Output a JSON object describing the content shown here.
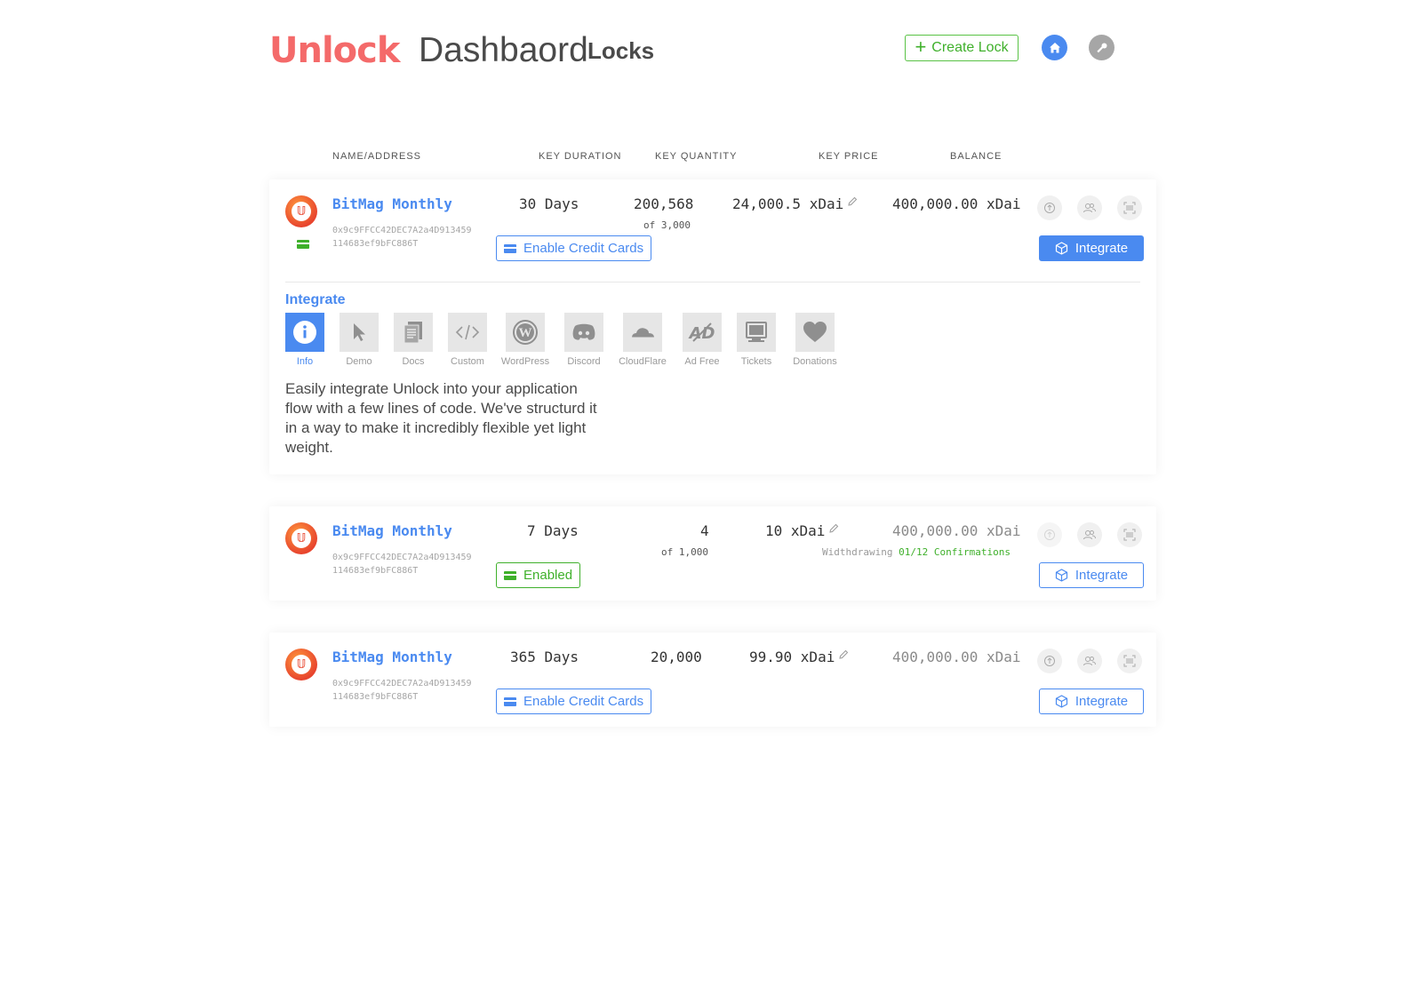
{
  "header": {
    "logo": "Unlock",
    "title": "Dashbaord",
    "subtitle": "Locks",
    "create_lock_label": "Create Lock"
  },
  "columns": {
    "name": "NAME/ADDRESS",
    "duration": "KEY DURATION",
    "quantity": "KEY QUANTITY",
    "price": "KEY PRICE",
    "balance": "BALANCE"
  },
  "locks": [
    {
      "name": "BitMag Monthly",
      "address": "0x9c9FFCC42DEC7A2a4D913459114683ef9bFC886T",
      "duration": "30 Days",
      "quantity": "200,568",
      "quantity_of": "of 3,000",
      "price": "24,000.5 xDai",
      "balance": "400,000.00 xDai",
      "cc_label": "Enable Credit Cards",
      "integrate_label": "Integrate"
    },
    {
      "name": "BitMag Monthly",
      "address": "0x9c9FFCC42DEC7A2a4D913459114683ef9bFC886T",
      "duration": "7 Days",
      "quantity": "4",
      "quantity_of": "of 1,000",
      "price": "10 xDai",
      "balance": "400,000.00 xDai",
      "withdraw_label": "Widthdrawing",
      "withdraw_confirmations": "01/12 Confirmations",
      "cc_label": "Enabled",
      "integrate_label": "Integrate"
    },
    {
      "name": "BitMag Monthly",
      "address": "0x9c9FFCC42DEC7A2a4D913459114683ef9bFC886T",
      "duration": "365 Days",
      "quantity": "20,000",
      "price": "99.90 xDai",
      "balance": "400,000.00 xDai",
      "cc_label": "Enable Credit Cards",
      "integrate_label": "Integrate"
    }
  ],
  "integrate_panel": {
    "title": "Integrate",
    "tabs": [
      {
        "label": "Info",
        "icon": "info-icon"
      },
      {
        "label": "Demo",
        "icon": "cursor-icon"
      },
      {
        "label": "Docs",
        "icon": "docs-icon"
      },
      {
        "label": "Custom",
        "icon": "code-icon"
      },
      {
        "label": "WordPress",
        "icon": "wordpress-icon"
      },
      {
        "label": "Discord",
        "icon": "discord-icon"
      },
      {
        "label": "CloudFlare",
        "icon": "cloudflare-icon"
      },
      {
        "label": "Ad Free",
        "icon": "ad-free-icon"
      },
      {
        "label": "Tickets",
        "icon": "tickets-icon"
      },
      {
        "label": "Donations",
        "icon": "heart-icon"
      }
    ],
    "active_tab": "Info",
    "description": "Easily integrate Unlock into your application flow with a few lines of code. We've structurd it in a way to make it incredibly flexible yet light weight."
  },
  "colors": {
    "brand": "#f46a6a",
    "accent": "#4a8af0",
    "success": "#3fb02b"
  }
}
